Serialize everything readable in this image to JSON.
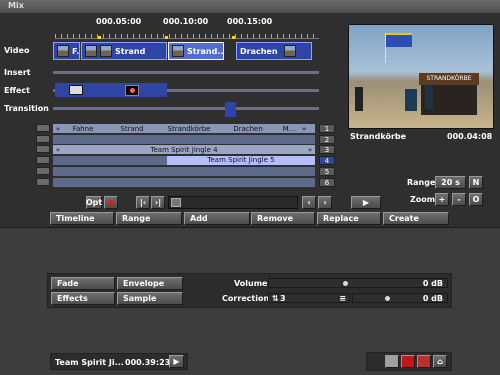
{
  "window": {
    "title": "Mix"
  },
  "ruler": {
    "timecodes": [
      "000.05:00",
      "000.10:00",
      "000.15:00"
    ]
  },
  "tracks": {
    "video_label": "Video",
    "insert_label": "Insert",
    "effect_label": "Effect",
    "transition_label": "Transition",
    "video_clips": [
      "F...",
      "Strand",
      "Strand...",
      "Drachen"
    ]
  },
  "scene_row": {
    "left_arrow": "«",
    "scenes": [
      "Fahne",
      "Strand",
      "Strandkörbe",
      "Drachen",
      "M..."
    ],
    "right_arrow": "»"
  },
  "audio_rows": [
    {
      "text": "Team Spirit Jingle 4",
      "left_arrow": "«",
      "right_arrow": "»"
    },
    {
      "text": "Team Spirit Jingle 5"
    }
  ],
  "track_numbers": [
    "1",
    "2",
    "3",
    "4",
    "5",
    "6"
  ],
  "preview": {
    "clip_name": "Strandkörbe",
    "timecode": "000.04:08",
    "sign_text": "STRANDKÖRBE"
  },
  "controls": {
    "opt_label": "Opt",
    "range_label": "Range",
    "range_value": "20 s",
    "range_n": "N",
    "zoom_label": "Zoom",
    "zoom_plus": "+",
    "zoom_minus": "-",
    "zoom_o": "O"
  },
  "actions": [
    "Timeline",
    "Range",
    "Add",
    "Remove",
    "Replace",
    "Create"
  ],
  "lower": {
    "buttons": [
      "Fade",
      "Envelope",
      "Effects",
      "Sample"
    ],
    "volume_label": "Volume",
    "volume_value": "0 dB",
    "volume_level": 0.5,
    "correction_label": "Correction",
    "correction_track": "3",
    "correction_value": "0 dB",
    "correction_level": 0.5
  },
  "status": {
    "clip_name": "Team Spirit Ji...",
    "timecode": "000.39:23"
  },
  "colors": {
    "clip": "#2e45a6",
    "clip_selected": "#546bd1",
    "timeline_marker": "#ffd21a",
    "record": "#d42020"
  }
}
